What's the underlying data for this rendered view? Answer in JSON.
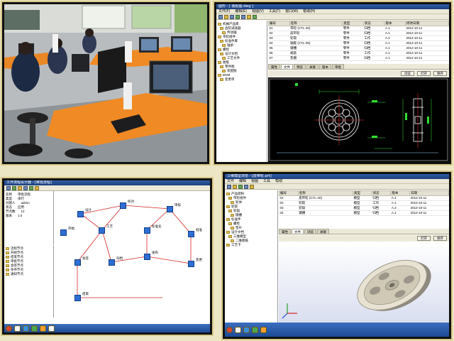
{
  "photo_panel": {
    "description_hidden": ""
  },
  "cad_window": {
    "title": "图形 - [ 装配图.dwg ]",
    "menu": [
      "文件(F)",
      "编辑(E)",
      "视图(V)",
      "工具(T)",
      "窗口(W)",
      "帮助(H)"
    ],
    "tree_items": [
      "机械产品库",
      "齿轮减速器",
      "传动轴",
      "带轮组件",
      "标准件库",
      "轴承",
      "螺栓",
      "设计文档",
      "工艺文件",
      "图纸",
      "零件图",
      "装配图",
      "BOM",
      "变更单"
    ],
    "table_headers": [
      "编号",
      "名称",
      "类型",
      "状态",
      "版本",
      "修改日期"
    ],
    "table_rows": [
      [
        "01",
        "带轮 (CTL-40)",
        "零件",
        "归档",
        "A.1",
        "2012-10-11"
      ],
      [
        "02",
        "皮带轮",
        "零件",
        "归档",
        "A.1",
        "2012-10-11"
      ],
      [
        "03",
        "轮毂",
        "零件",
        "工作",
        "A.2",
        "2012-10-11"
      ],
      [
        "04",
        "轴套 (CTL-05)",
        "零件",
        "归档",
        "A.1",
        "2012-10-11"
      ],
      [
        "05",
        "键槽",
        "零件",
        "归档",
        "A.1",
        "2012-10-11"
      ],
      [
        "06",
        "端盖",
        "零件",
        "工作",
        "A.1",
        "2012-10-11"
      ],
      [
        "07",
        "垫圈",
        "零件",
        "归档",
        "A.1",
        "2012-10-11"
      ]
    ],
    "tabs": [
      "属性",
      "文件",
      "预览",
      "关联",
      "版本",
      "审批"
    ],
    "buttons": [
      "浏览",
      "打开",
      "保存"
    ]
  },
  "flow_window": {
    "title": "工作流程设计器 - [审批流程]",
    "props": [
      [
        "名称",
        "审批流程"
      ],
      [
        "类型",
        "串行"
      ],
      [
        "创建人",
        "admin"
      ],
      [
        "状态",
        "启用"
      ],
      [
        "节点数",
        "12"
      ],
      [
        "版本",
        "1.0"
      ]
    ],
    "side_list": [
      "流程节点",
      "开始节点",
      "结束节点",
      "审批节点",
      "会签节点",
      "条件节点",
      "通知节点"
    ],
    "nodes": [
      {
        "label": "开始"
      },
      {
        "label": "设计"
      },
      {
        "label": "校对"
      },
      {
        "label": "审核"
      },
      {
        "label": "工艺"
      },
      {
        "label": "标准化"
      },
      {
        "label": "批准"
      },
      {
        "label": "会签"
      },
      {
        "label": "归档"
      },
      {
        "label": "发布"
      },
      {
        "label": "变更"
      },
      {
        "label": "结束"
      }
    ]
  },
  "model_window": {
    "title": "三维模型浏览 - [皮带轮.prt]",
    "menu": [
      "文件",
      "编辑",
      "视图",
      "工具",
      "帮助"
    ],
    "tree_items": [
      "产品结构",
      "带轮组件",
      "轮体",
      "轮毂",
      "轮辐",
      "键槽",
      "标准件",
      "螺栓",
      "垫片",
      "设计文档",
      "三维模型",
      "二维图纸",
      "工艺卡"
    ],
    "table_headers": [
      "编号",
      "名称",
      "类型",
      "状态",
      "版本",
      "日期"
    ],
    "table_rows": [
      [
        "01",
        "皮带轮 (CTL-40)",
        "模型",
        "归档",
        "A.1",
        "2012-10-11"
      ],
      [
        "02",
        "轮毂",
        "模型",
        "工作",
        "A.1",
        "2012-10-11"
      ],
      [
        "03",
        "轮辐",
        "模型",
        "归档",
        "A.2",
        "2012-10-11"
      ],
      [
        "04",
        "键槽",
        "模型",
        "归档",
        "A.1",
        "2012-10-11"
      ]
    ],
    "tabs": [
      "属性",
      "文件",
      "浏览",
      "关联"
    ],
    "buttons": [
      "打开",
      "保存"
    ]
  },
  "colors": {
    "title_blue": "#1c3f7c",
    "accent_orange": "#f08a24",
    "frame_gold": "#d8c98a"
  }
}
